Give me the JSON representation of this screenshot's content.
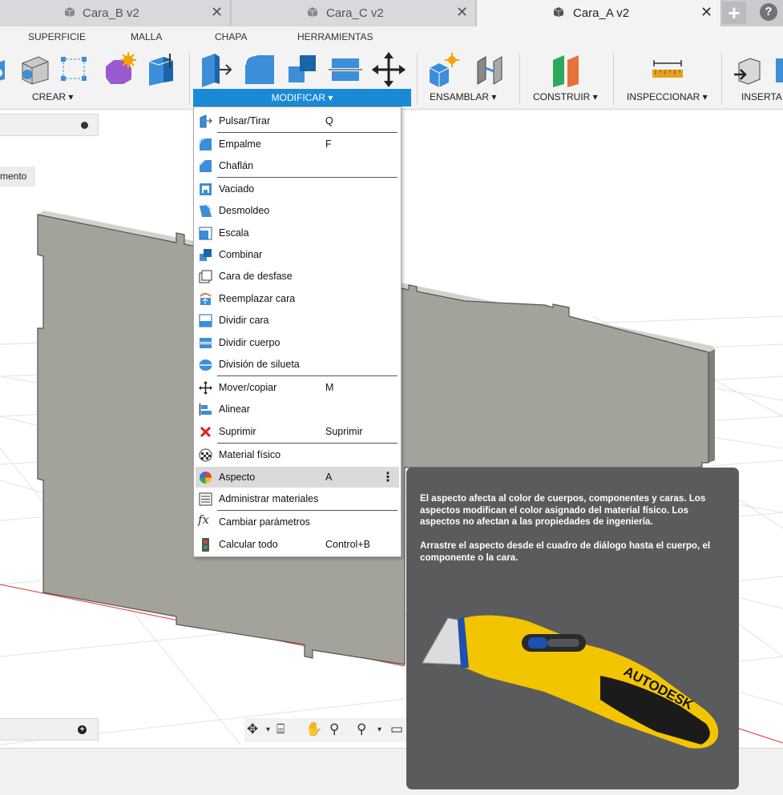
{
  "tabs": [
    {
      "label": "Cara_B v2",
      "active": false
    },
    {
      "label": "Cara_C v2",
      "active": false
    },
    {
      "label": "Cara_A v2",
      "active": true
    }
  ],
  "ribbon": {
    "workspace_tabs": [
      "SUPERFICIE",
      "MALLA",
      "CHAPA",
      "HERRAMIENTAS"
    ],
    "groups": {
      "crear": "CREAR ▾",
      "modificar": "MODIFICAR ▾",
      "ensamblar": "ENSAMBLAR ▾",
      "construir": "CONSTRUIR ▾",
      "inspeccionar": "INSPECCIONAR ▾",
      "insertar": "INSERTA"
    }
  },
  "browser": {
    "timeline_button": "mento"
  },
  "menu": {
    "items": [
      {
        "label": "Pulsar/Tirar",
        "shortcut": "Q",
        "icon": "press-pull-icon"
      },
      {
        "label": "Empalme",
        "shortcut": "F",
        "icon": "fillet-icon"
      },
      {
        "label": "Chaflán",
        "shortcut": "",
        "icon": "chamfer-icon"
      },
      {
        "label": "Vaciado",
        "shortcut": "",
        "icon": "shell-icon"
      },
      {
        "label": "Desmoldeo",
        "shortcut": "",
        "icon": "draft-icon"
      },
      {
        "label": "Escala",
        "shortcut": "",
        "icon": "scale-icon"
      },
      {
        "label": "Combinar",
        "shortcut": "",
        "icon": "combine-icon"
      },
      {
        "label": "Cara de desfase",
        "shortcut": "",
        "icon": "offset-face-icon"
      },
      {
        "label": "Reemplazar cara",
        "shortcut": "",
        "icon": "replace-face-icon"
      },
      {
        "label": "Dividir cara",
        "shortcut": "",
        "icon": "split-face-icon"
      },
      {
        "label": "Dividir cuerpo",
        "shortcut": "",
        "icon": "split-body-icon"
      },
      {
        "label": "División de silueta",
        "shortcut": "",
        "icon": "silhouette-split-icon"
      },
      {
        "label": "Mover/copiar",
        "shortcut": "M",
        "icon": "move-icon"
      },
      {
        "label": "Alinear",
        "shortcut": "",
        "icon": "align-icon"
      },
      {
        "label": "Suprimir",
        "shortcut": "Suprimir",
        "icon": "delete-icon"
      },
      {
        "label": "Material físico",
        "shortcut": "",
        "icon": "physical-material-icon"
      },
      {
        "label": "Aspecto",
        "shortcut": "A",
        "icon": "appearance-icon",
        "highlighted": true
      },
      {
        "label": "Administrar materiales",
        "shortcut": "",
        "icon": "manage-materials-icon"
      },
      {
        "label": "Cambiar parámetros",
        "shortcut": "",
        "icon": "change-parameters-icon"
      },
      {
        "label": "Calcular todo",
        "shortcut": "Control+B",
        "icon": "compute-all-icon"
      }
    ]
  },
  "tooltip": {
    "description": "El aspecto afecta al color de cuerpos, componentes y caras. Los aspectos modifican el color asignado del material físico. Los aspectos no afectan a las propiedades de ingeniería.",
    "instruction": "Arrastre el aspecto desde el cuadro de diálogo hasta el cuerpo, el componente o la cara.",
    "brand": "AUTODESK"
  },
  "colors": {
    "accent": "#1b8ad6",
    "tooltip_bg": "#5a5b5d",
    "body_gray": "#a3a39c",
    "knife_yellow": "#f2c500"
  }
}
